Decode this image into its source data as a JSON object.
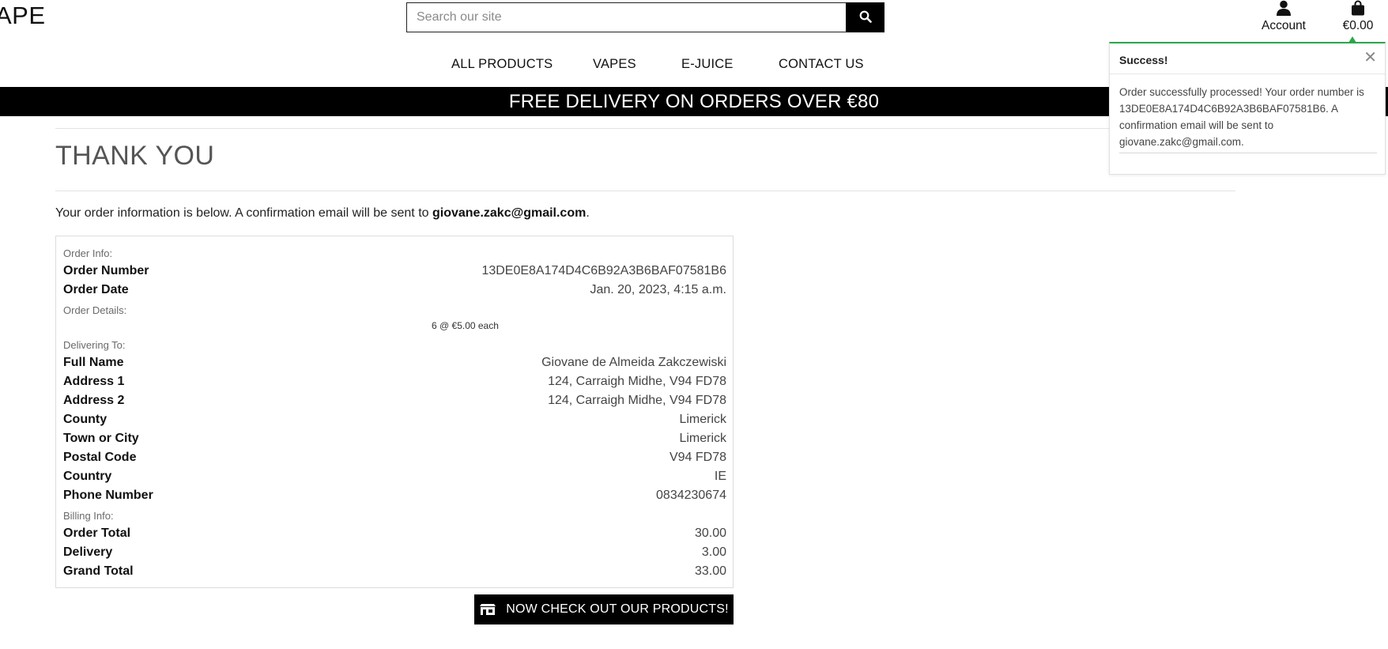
{
  "header": {
    "logo_text": "APE",
    "search_placeholder": "Search our site",
    "account_label": "Account",
    "bag_total": "€0.00"
  },
  "nav": {
    "items": [
      "ALL PRODUCTS",
      "VAPES",
      "E-JUICE",
      "CONTACT US"
    ]
  },
  "banner": {
    "text": "FREE DELIVERY ON ORDERS OVER €80"
  },
  "main": {
    "title": "THANK YOU",
    "intro_prefix": "Your order information is below. A confirmation email will be sent to ",
    "intro_email": "giovane.zakc@gmail.com",
    "intro_suffix": "."
  },
  "order": {
    "sections": {
      "order_info": "Order Info:",
      "order_details": "Order Details:",
      "delivering_to": "Delivering To:",
      "billing_info": "Billing Info:"
    },
    "order_number": {
      "label": "Order Number",
      "value": "13DE0E8A174D4C6B92A3B6BAF07581B6"
    },
    "order_date": {
      "label": "Order Date",
      "value": "Jan. 20, 2023, 4:15 a.m."
    },
    "item_line": "6 @ €5.00 each",
    "full_name": {
      "label": "Full Name",
      "value": "Giovane de Almeida Zakczewiski"
    },
    "address1": {
      "label": "Address 1",
      "value": "124, Carraigh Midhe, V94 FD78"
    },
    "address2": {
      "label": "Address 2",
      "value": "124, Carraigh Midhe, V94 FD78"
    },
    "county": {
      "label": "County",
      "value": "Limerick"
    },
    "town": {
      "label": "Town or City",
      "value": "Limerick"
    },
    "postal": {
      "label": "Postal Code",
      "value": "V94 FD78"
    },
    "country": {
      "label": "Country",
      "value": "IE"
    },
    "phone": {
      "label": "Phone Number",
      "value": "0834230674"
    },
    "order_total": {
      "label": "Order Total",
      "value": "30.00"
    },
    "delivery": {
      "label": "Delivery",
      "value": "3.00"
    },
    "grand_total": {
      "label": "Grand Total",
      "value": "33.00"
    }
  },
  "cta": {
    "label": "NOW CHECK OUT OUR PRODUCTS!"
  },
  "toast": {
    "title": "Success!",
    "message": "Order successfully processed! Your order number is 13DE0E8A174D4C6B92A3B6BAF07581B6. A confirmation email will be sent to giovane.zakc@gmail.com.",
    "accent_color": "#2aa84a"
  }
}
